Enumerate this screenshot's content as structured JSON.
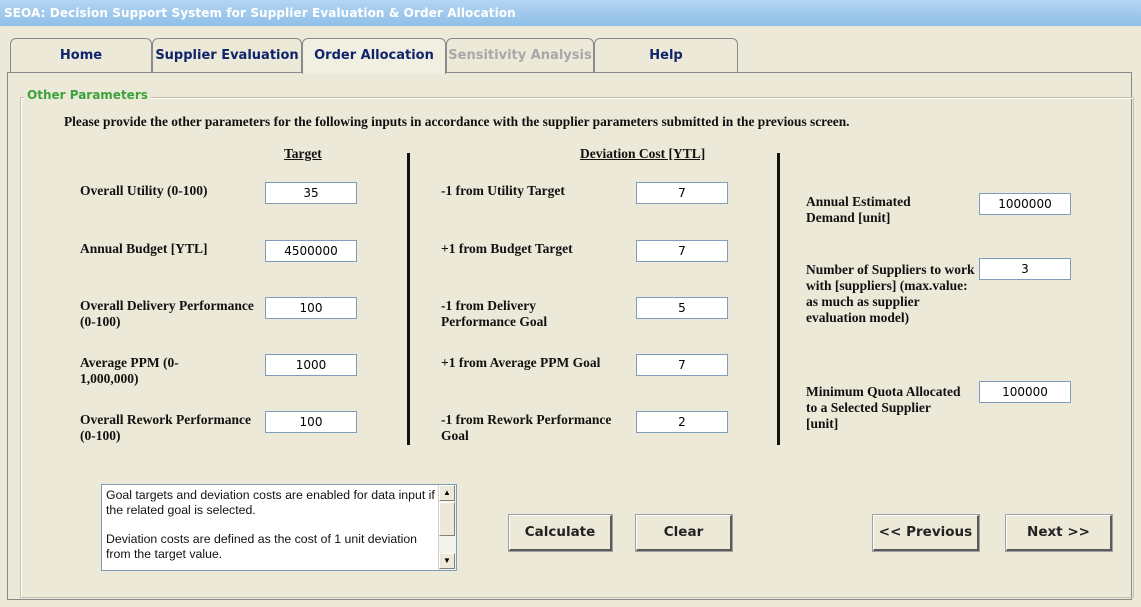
{
  "window": {
    "title": "SEOA: Decision Support System for Supplier Evaluation & Order Allocation"
  },
  "tabs": [
    {
      "label": "Home",
      "state": "normal"
    },
    {
      "label": "Supplier Evaluation",
      "state": "normal"
    },
    {
      "label": "Order Allocation",
      "state": "active"
    },
    {
      "label": "Sensitivity Analysis",
      "state": "disabled"
    },
    {
      "label": "Help",
      "state": "normal"
    }
  ],
  "group": {
    "title": "Other Parameters"
  },
  "instruction": "Please provide the other parameters for the following inputs in accordance with the supplier parameters submitted in the previous screen.",
  "target": {
    "header": "Target",
    "rows": [
      {
        "label": "Overall Utility (0-100)",
        "value": "35"
      },
      {
        "label": "Annual Budget [YTL]",
        "value": "4500000"
      },
      {
        "label": "Overall Delivery Performance (0-100)",
        "value": "100"
      },
      {
        "label": "Average PPM (0-1,000,000)",
        "value": "1000"
      },
      {
        "label": "Overall Rework Performance (0-100)",
        "value": "100"
      }
    ]
  },
  "deviation": {
    "header": "Deviation Cost [YTL]",
    "rows": [
      {
        "label": "-1 from Utility Target",
        "value": "7"
      },
      {
        "label": "+1 from Budget Target",
        "value": "7"
      },
      {
        "label": "-1 from Delivery Performance Goal",
        "value": "5"
      },
      {
        "label": "+1 from Average PPM Goal",
        "value": "7"
      },
      {
        "label": "-1 from Rework Performance Goal",
        "value": "2"
      }
    ]
  },
  "other": {
    "rows": [
      {
        "label": "Annual Estimated Demand [unit]",
        "value": "1000000"
      },
      {
        "label": "Number of Suppliers to work with [suppliers] (max.value: as much as supplier evaluation model)",
        "value": "3"
      },
      {
        "label": "Minimum Quota Allocated to a Selected Supplier [unit]",
        "value": "100000"
      }
    ]
  },
  "memo": {
    "paragraph1": "Goal targets and deviation costs are enabled for data input if the related goal is selected.",
    "paragraph2": "Deviation costs are defined as the cost of 1 unit deviation from the target value."
  },
  "buttons": {
    "calculate": "Calculate",
    "clear": "Clear",
    "previous": "<< Previous",
    "next": "Next >>"
  },
  "icons": {
    "scroll_up": "arrow-up-icon",
    "scroll_down": "arrow-down-icon"
  }
}
